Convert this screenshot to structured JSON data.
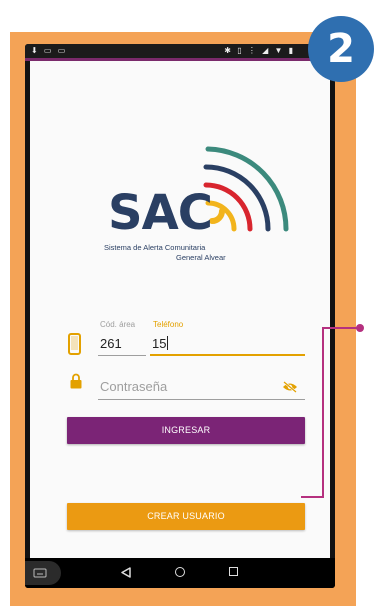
{
  "step_badge": "2",
  "logo": {
    "wordmark": "SAC",
    "subtitle_line1": "Sistema de Alerta Comunitaria",
    "subtitle_line2": "General Alvear"
  },
  "form": {
    "area_code": {
      "label": "Cód. área",
      "value": "261"
    },
    "phone": {
      "label": "Teléfono",
      "value": "15"
    },
    "password": {
      "placeholder": "Contraseña"
    },
    "login_button": "INGRESAR",
    "create_user_button": "CREAR USUARIO"
  },
  "icons": {
    "phone": "smartphone-icon",
    "lock": "lock-icon",
    "eye": "eye-off-icon",
    "nav_back": "back-triangle-icon",
    "nav_home": "home-circle-icon",
    "nav_recent": "recent-square-icon",
    "keyboard": "keyboard-icon"
  },
  "colors": {
    "frame": "#f4a356",
    "badge": "#2f6fb0",
    "login_button": "#7b2476",
    "create_button": "#eb9a12",
    "accent": "#e3a100",
    "logo_text": "#2a3f63"
  }
}
